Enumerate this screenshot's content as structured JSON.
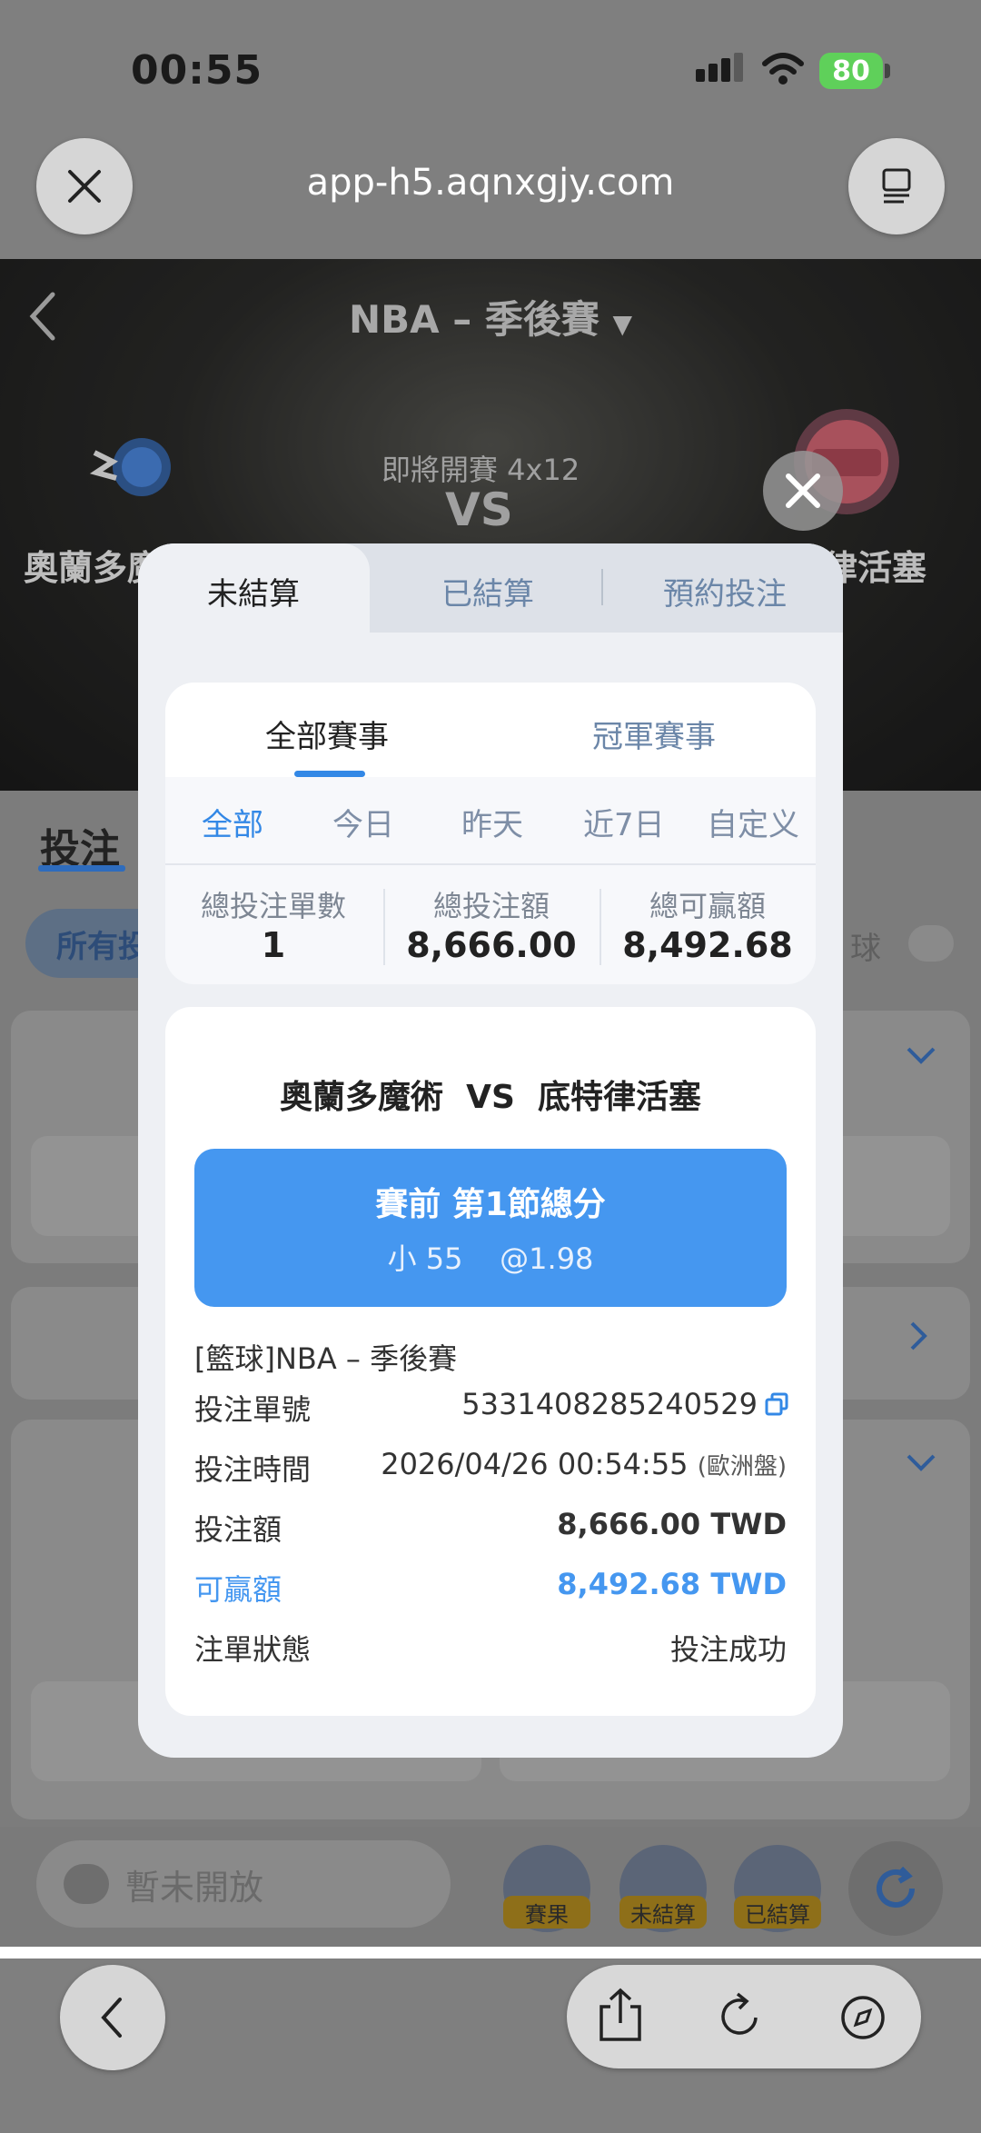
{
  "status_bar": {
    "time": "00:55",
    "battery": "80"
  },
  "browser": {
    "url": "app-h5.aqnxgjy.com"
  },
  "header": {
    "league_title": "NBA – 季後賽",
    "upcoming": "即將開賽 4x12",
    "vs": "VS",
    "home_team": "奧蘭多魔術",
    "away_team": "底特律活塞",
    "home_team_visible": "奧蘭多魔",
    "away_team_visible": "律活塞"
  },
  "page": {
    "tab_bet": "投注",
    "filter_all": "所有投",
    "ball_label": "球"
  },
  "bottom_bar": {
    "chat_placeholder": "暫未開放",
    "tools": [
      {
        "label": "賽果"
      },
      {
        "label": "未結算"
      },
      {
        "label": "已結算"
      }
    ]
  },
  "modal": {
    "tabs": [
      "未結算",
      "已結算",
      "預約投注"
    ],
    "segments": [
      "全部賽事",
      "冠軍賽事"
    ],
    "ranges": [
      "全部",
      "今日",
      "昨天",
      "近7日",
      "自定义"
    ],
    "summary": [
      {
        "label": "總投注單數",
        "value": "1"
      },
      {
        "label": "總投注額",
        "value": "8,666.00"
      },
      {
        "label": "總可贏額",
        "value": "8,492.68"
      }
    ],
    "bet": {
      "match": "奧蘭多魔術  VS  底特律活塞",
      "market": "賽前 第1節總分",
      "selection": "小 55    @1.98",
      "sport_league": "[籃球]NBA – 季後賽",
      "rows": [
        {
          "label": "投注單號",
          "value": "5331408285240529"
        },
        {
          "label": "投注時間",
          "value": "2026/04/26 00:54:55",
          "suffix": "(歐洲盤)"
        },
        {
          "label": "投注額",
          "value": "8,666.00 TWD"
        },
        {
          "label": "可贏額",
          "value": "8,492.68 TWD"
        },
        {
          "label": "注單狀態",
          "value": "投注成功"
        }
      ]
    }
  },
  "colors": {
    "accent_blue": "#4597f0",
    "active_blue": "#3388e6",
    "battery_green": "#5fd05a"
  }
}
